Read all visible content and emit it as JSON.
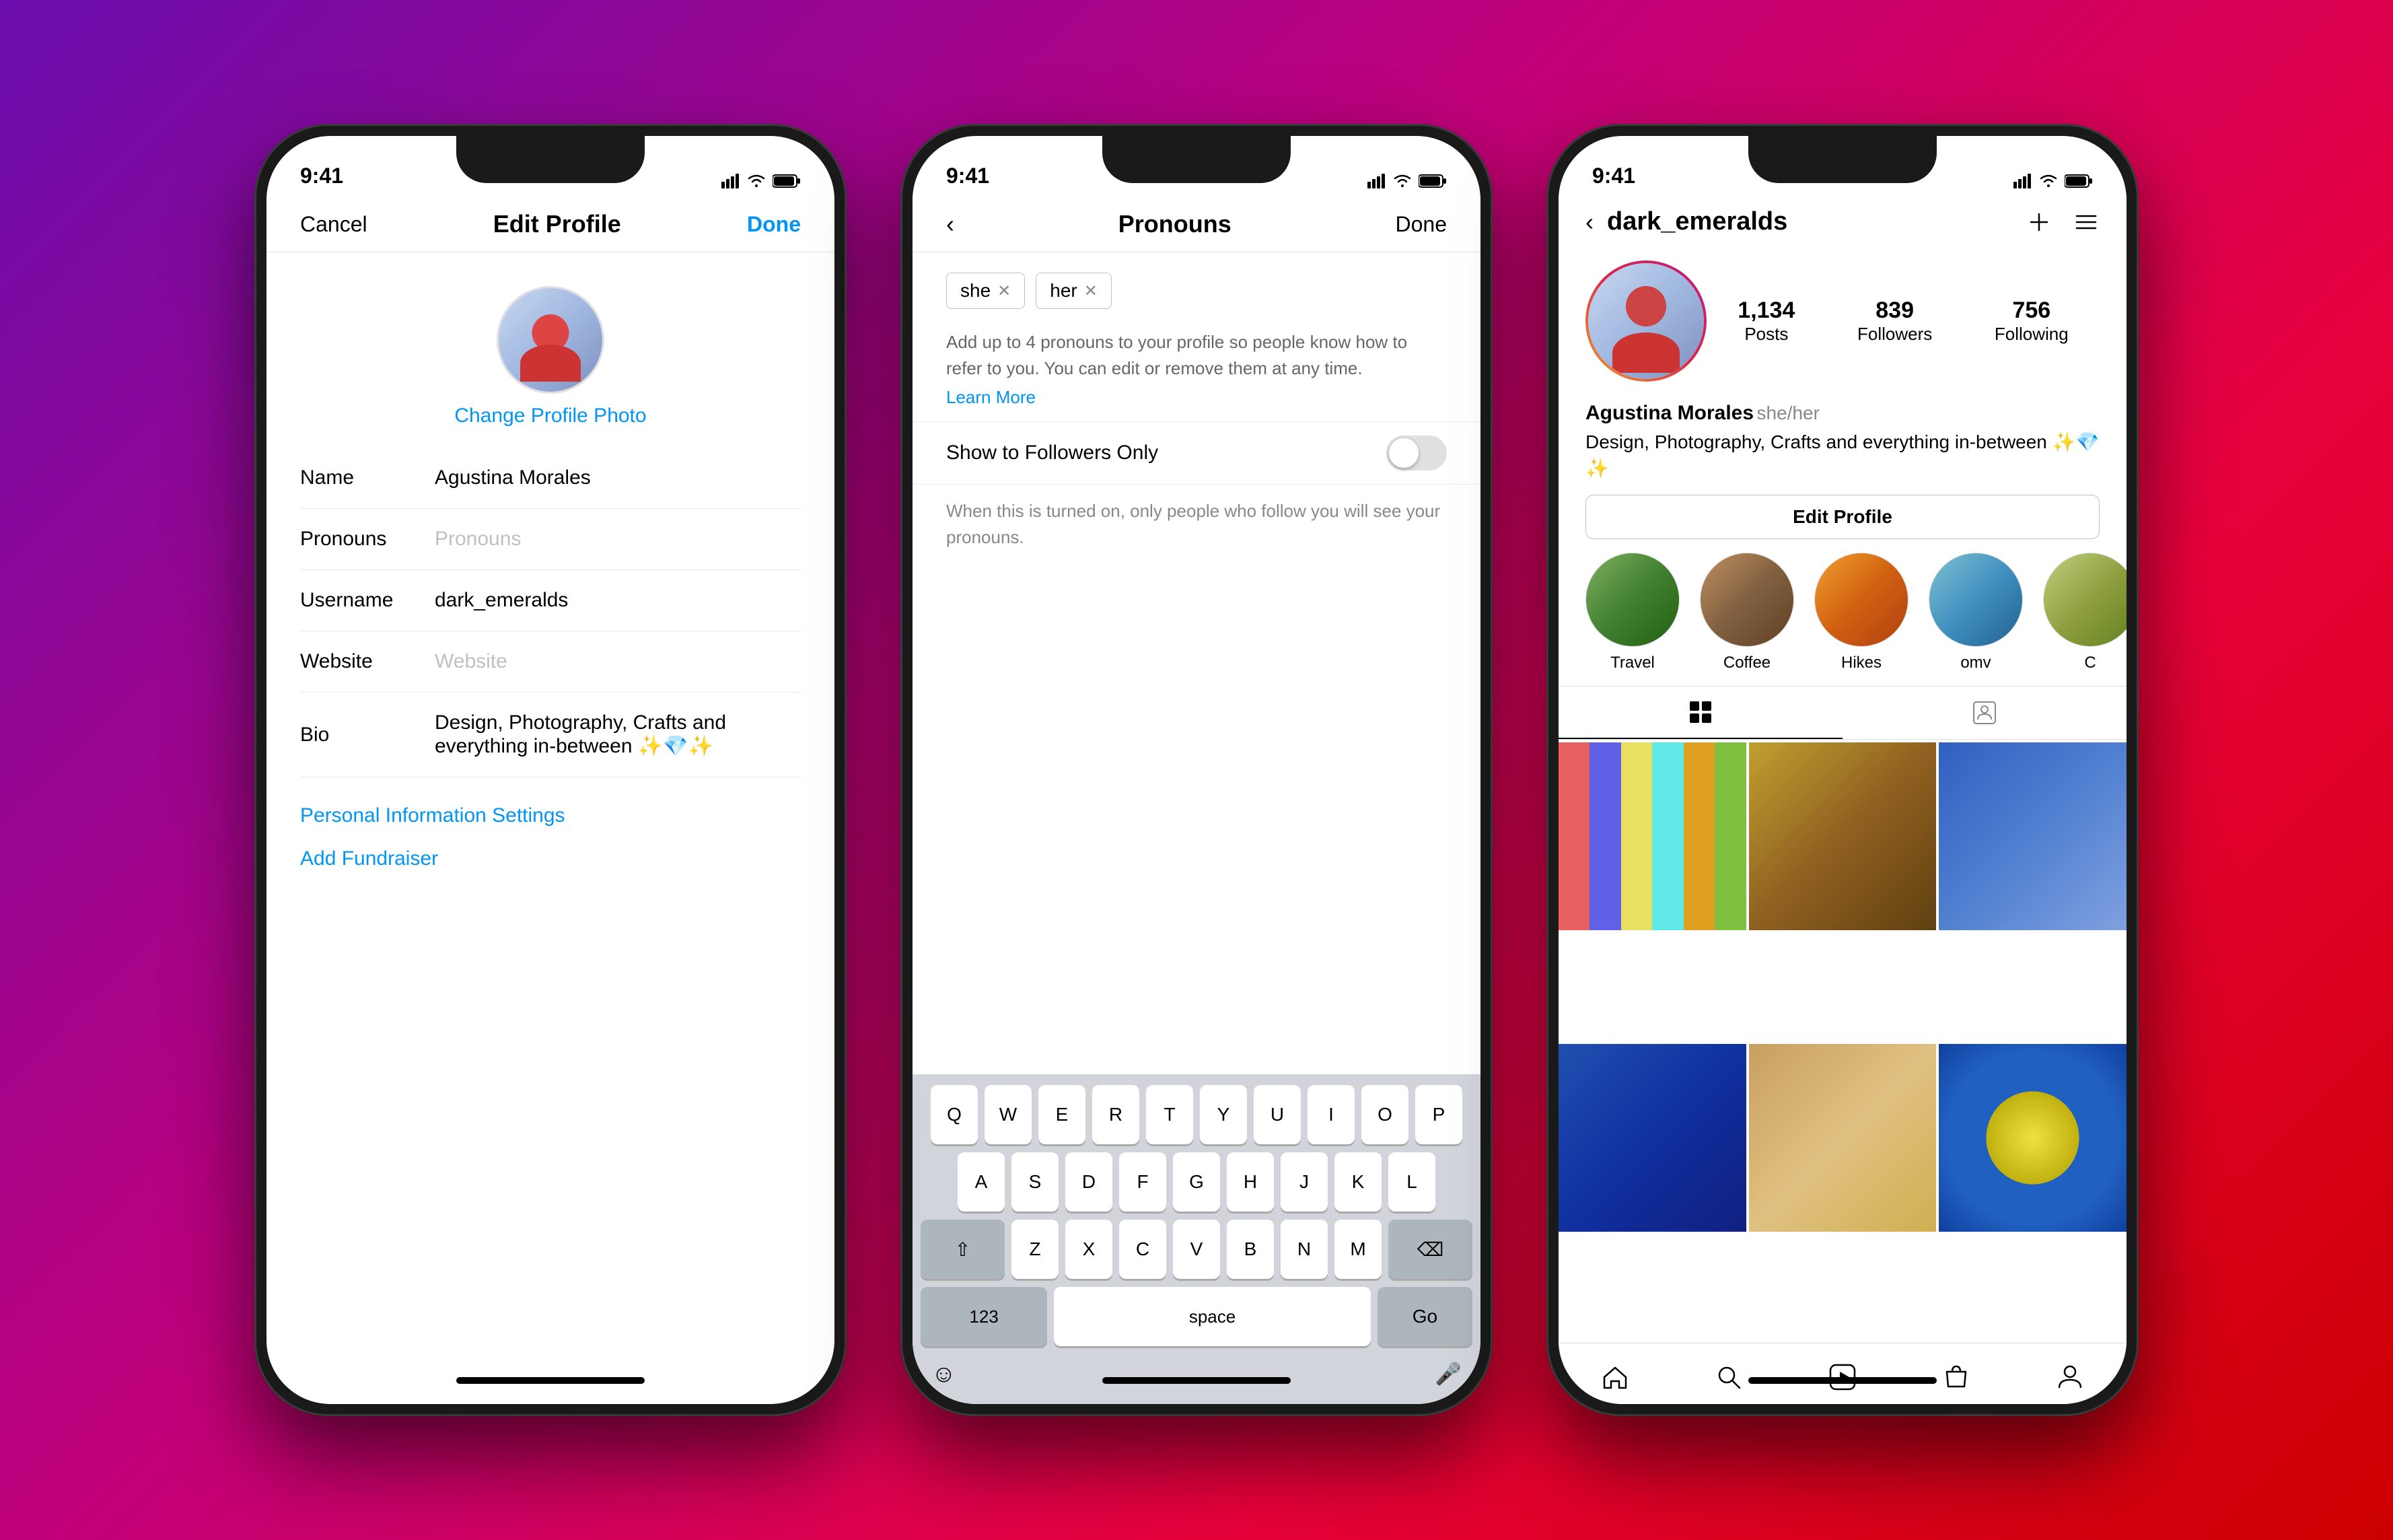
{
  "background": {
    "gradient": "135deg, #6a0dad, #c0007a, #e8003a, #cc0000"
  },
  "phone1": {
    "status_time": "9:41",
    "nav": {
      "cancel": "Cancel",
      "title": "Edit Profile",
      "done": "Done"
    },
    "change_photo": "Change Profile Photo",
    "fields": [
      {
        "label": "Name",
        "value": "Agustina Morales",
        "placeholder": false
      },
      {
        "label": "Pronouns",
        "value": "Pronouns",
        "placeholder": true
      },
      {
        "label": "Username",
        "value": "dark_emeralds",
        "placeholder": false
      },
      {
        "label": "Website",
        "value": "Website",
        "placeholder": true
      },
      {
        "label": "Bio",
        "value": "Design, Photography, Crafts and everything in-between ✨💎✨",
        "placeholder": false
      }
    ],
    "links": [
      "Personal Information Settings",
      "Add Fundraiser"
    ]
  },
  "phone2": {
    "status_time": "9:41",
    "nav": {
      "title": "Pronouns",
      "done": "Done"
    },
    "tags": [
      "she",
      "her"
    ],
    "description": "Add up to 4 pronouns to your profile so people know how to refer to you. You can edit or remove them at any time.",
    "learn_more": "Learn More",
    "toggle_label": "Show to Followers Only",
    "toggle_description": "When this is turned on, only people who follow you will see your pronouns.",
    "keyboard": {
      "rows": [
        [
          "Q",
          "W",
          "E",
          "R",
          "T",
          "Y",
          "U",
          "I",
          "O",
          "P"
        ],
        [
          "A",
          "S",
          "D",
          "F",
          "G",
          "H",
          "J",
          "K",
          "L"
        ],
        [
          "⇧",
          "Z",
          "X",
          "C",
          "V",
          "B",
          "N",
          "M",
          "⌫"
        ],
        [
          "123",
          "space",
          "Go"
        ]
      ]
    }
  },
  "phone3": {
    "status_time": "9:41",
    "username": "dark_emeralds",
    "stats": {
      "posts": "1,134",
      "posts_label": "Posts",
      "followers": "839",
      "followers_label": "Followers",
      "following": "756",
      "following_label": "Following"
    },
    "bio": {
      "name": "Agustina Morales",
      "pronouns": "she/her",
      "text": "Design, Photography, Crafts and everything in-between ✨💎✨"
    },
    "edit_profile_btn": "Edit Profile",
    "highlights": [
      {
        "label": "Travel",
        "class": "hl-travel"
      },
      {
        "label": "Coffee",
        "class": "hl-coffee"
      },
      {
        "label": "Hikes",
        "class": "hl-hikes"
      },
      {
        "label": "omv",
        "class": "hl-omv"
      },
      {
        "label": "C",
        "class": "hl-c"
      }
    ]
  }
}
